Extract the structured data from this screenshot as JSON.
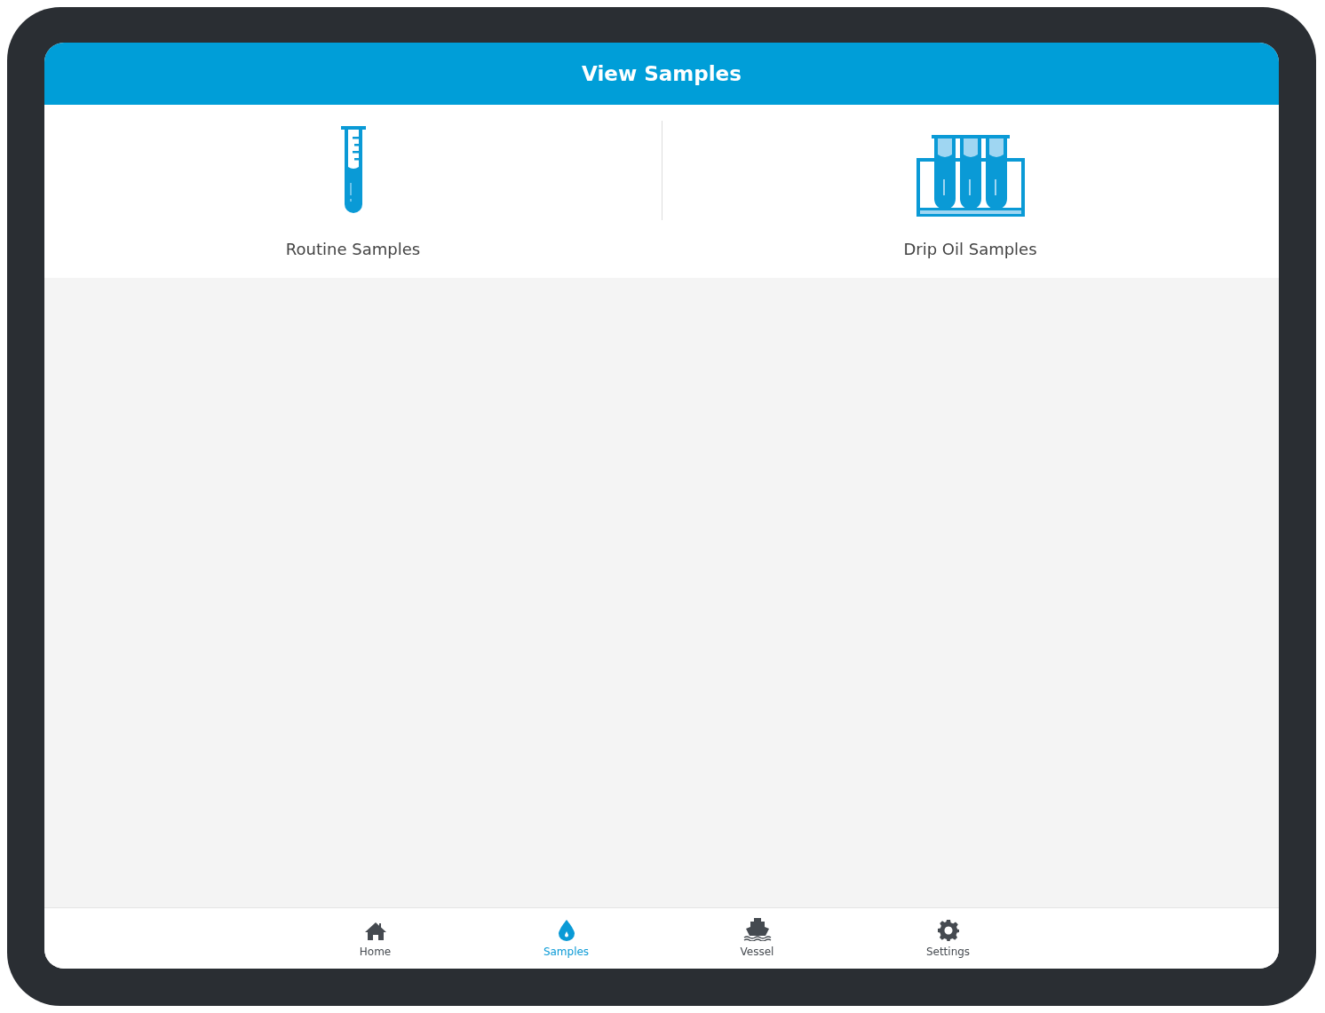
{
  "header": {
    "title": "View Samples"
  },
  "options": [
    {
      "kind": "single-tube",
      "label": "Routine Samples"
    },
    {
      "kind": "tube-rack",
      "label": "Drip Oil Samples"
    }
  ],
  "nav": [
    {
      "kind": "home",
      "label": "Home",
      "selected": false
    },
    {
      "kind": "drop",
      "label": "Samples",
      "selected": true
    },
    {
      "kind": "ship",
      "label": "Vessel",
      "selected": false
    },
    {
      "kind": "gear",
      "label": "Settings",
      "selected": false
    }
  ]
}
